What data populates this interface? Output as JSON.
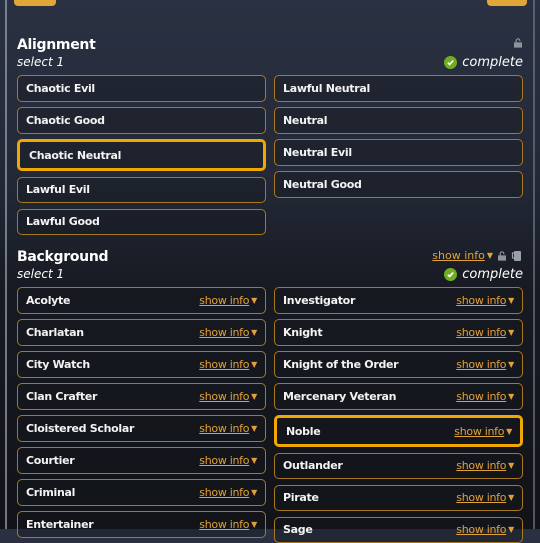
{
  "header": {
    "clipped_title": "Background"
  },
  "alignment": {
    "title": "Alignment",
    "subtitle": "select 1",
    "status": "complete",
    "left": [
      "Chaotic Evil",
      "Chaotic Good",
      "Chaotic Neutral",
      "Lawful Evil",
      "Lawful Good"
    ],
    "right": [
      "Lawful Neutral",
      "Neutral",
      "Neutral Evil",
      "Neutral Good"
    ],
    "selected": "Chaotic Neutral"
  },
  "background": {
    "title": "Background",
    "subtitle": "select 1",
    "status": "complete",
    "show_info_label": "show info",
    "left": [
      "Acolyte",
      "Charlatan",
      "City Watch",
      "Clan Crafter",
      "Cloistered Scholar",
      "Courtier",
      "Criminal",
      "Entertainer"
    ],
    "right": [
      "Investigator",
      "Knight",
      "Knight of the Order",
      "Mercenary Veteran",
      "Noble",
      "Outlander",
      "Pirate",
      "Sage"
    ],
    "selected": "Noble"
  },
  "colors": {
    "accent": "#f0a800",
    "border": "#a7781f",
    "link": "#e0a13a",
    "complete": "#6fae20"
  }
}
